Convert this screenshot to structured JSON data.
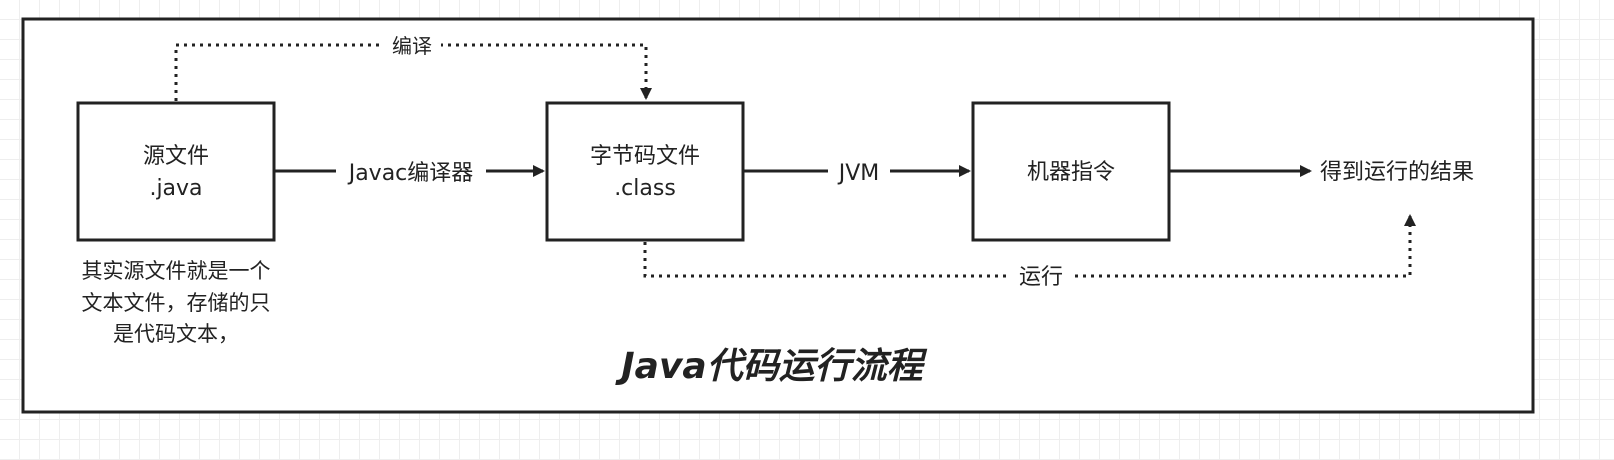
{
  "boxes": {
    "source": {
      "line1": "源文件",
      "line2": ".java"
    },
    "bytecode": {
      "line1": "字节码文件",
      "line2": ".class"
    },
    "machine": {
      "line1": "机器指令"
    }
  },
  "arrows": {
    "compile_top": "编译",
    "javac": "Javac编译器",
    "jvm": "JVM",
    "run": "运行"
  },
  "result": "得到运行的结果",
  "note": {
    "line1": "其实源文件就是一个",
    "line2": "文本文件，存储的只",
    "line3": "是代码文本，"
  },
  "title": "Java代码运行流程",
  "colors": {
    "stroke": "#222222",
    "background": "#ffffff",
    "grid": "#eeeeee"
  }
}
